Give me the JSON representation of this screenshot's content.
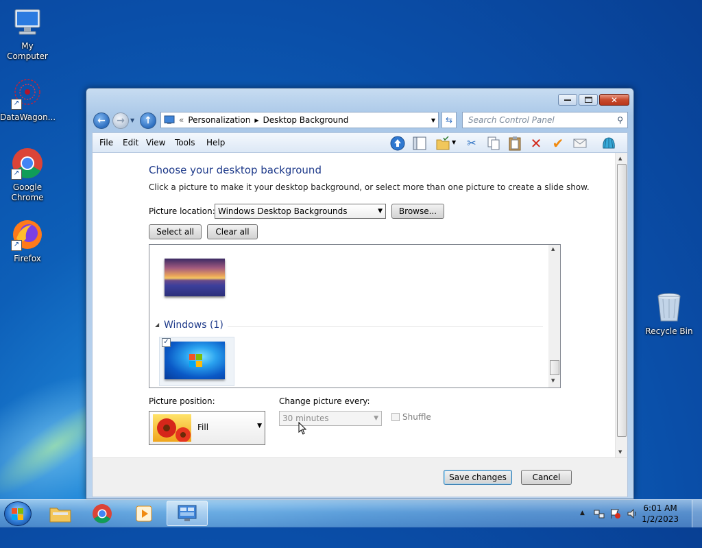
{
  "desktop": {
    "icons": [
      {
        "label": "My Computer"
      },
      {
        "label": "DataWagon..."
      },
      {
        "label": "Google Chrome"
      },
      {
        "label": "Firefox"
      },
      {
        "label": "Recycle Bin"
      }
    ]
  },
  "window": {
    "address": {
      "overflow": "«",
      "crumbs": [
        "Personalization",
        "Desktop Background"
      ],
      "search_placeholder": "Search Control Panel"
    },
    "menu": [
      "File",
      "Edit",
      "View",
      "Tools",
      "Help"
    ],
    "toolbar_icons": [
      "up-arrow-icon",
      "pane-icon",
      "folder-check-icon",
      "cut-icon",
      "copy-icon",
      "paste-icon",
      "delete-icon",
      "checkmark-icon",
      "mail-icon",
      "shell-icon"
    ],
    "content": {
      "heading": "Choose your desktop background",
      "description": "Click a picture to make it your desktop background, or select more than one picture to create a slide show.",
      "picture_location_label": "Picture location:",
      "picture_location_value": "Windows Desktop Backgrounds",
      "browse_label": "Browse...",
      "select_all_label": "Select all",
      "clear_all_label": "Clear all",
      "group_title": "Windows (1)",
      "picture_position_label": "Picture position:",
      "picture_position_value": "Fill",
      "change_every_label": "Change picture every:",
      "change_every_value": "30 minutes",
      "shuffle_label": "Shuffle"
    },
    "footer": {
      "save_label": "Save changes",
      "cancel_label": "Cancel"
    }
  },
  "taskbar": {
    "time": "6:01 AM",
    "date": "1/2/2023"
  }
}
